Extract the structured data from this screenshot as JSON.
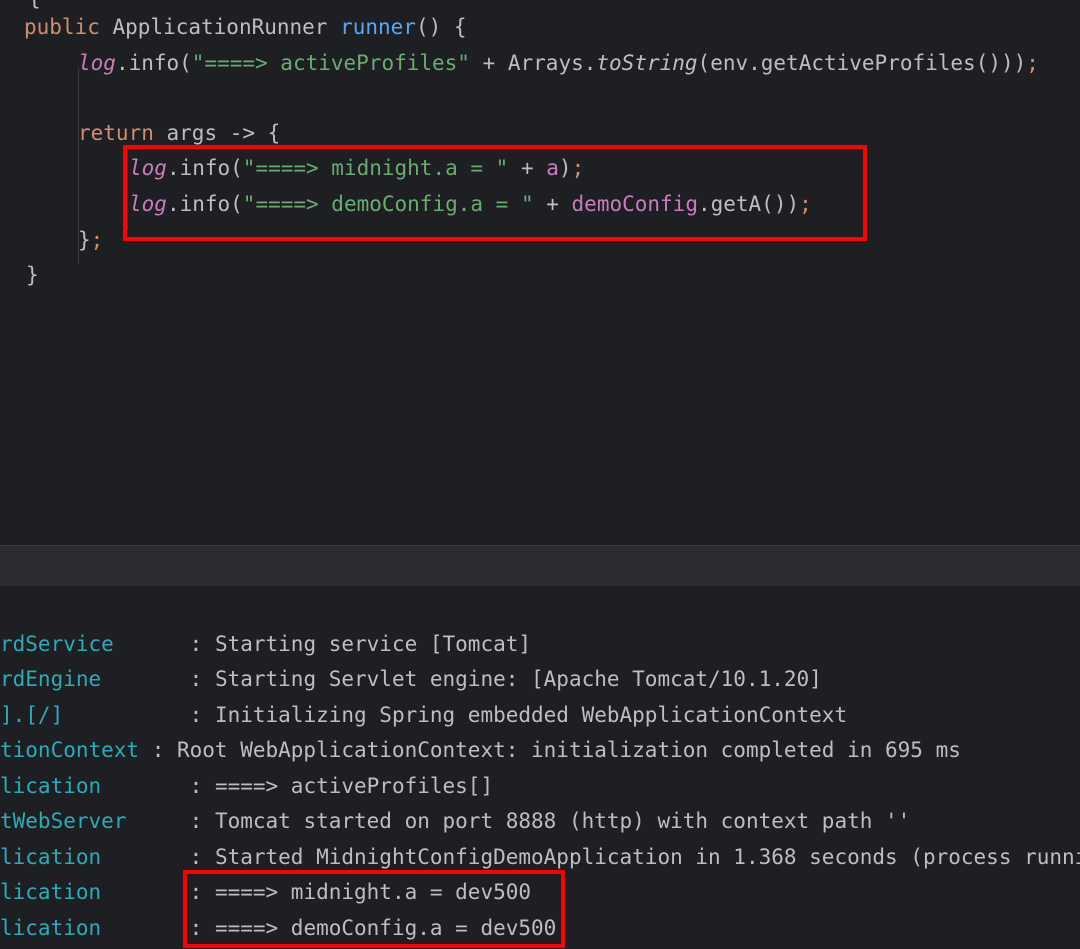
{
  "editor": {
    "partial_top": "{",
    "lines": {
      "l1": {
        "kw": "public ",
        "type": "ApplicationRunner ",
        "method": "runner",
        "rest": "() {"
      },
      "l2": {
        "log": "log",
        "dot": ".info(",
        "str": "\"====> activeProfiles\"",
        "plus": " + Arrays.",
        "sfn": "toString",
        "p1": "(env.getActiveProfiles()))",
        "semi": ";"
      },
      "l4": {
        "kw": "return ",
        "rest": "args -> {"
      },
      "l5": {
        "log": "log",
        "dot": ".info(",
        "str": "\"====> midnight.a = \"",
        "plus": " + ",
        "var": "a",
        "end": ")",
        "semi": ";"
      },
      "l6": {
        "log": "log",
        "dot": ".info(",
        "str": "\"====> demoConfig.a = \"",
        "plus": " + ",
        "var": "demoConfig",
        "end": ".getA())",
        "semi": ";"
      },
      "l7": {
        "brace": "}",
        "semi": ";"
      },
      "l8": {
        "brace": "}"
      }
    }
  },
  "console": {
    "lines": [
      {
        "logger": "rdService      ",
        "msg": ": Starting service [Tomcat]"
      },
      {
        "logger": "rdEngine       ",
        "msg": ": Starting Servlet engine: [Apache Tomcat/10.1.20]"
      },
      {
        "logger": "].[/]          ",
        "msg": ": Initializing Spring embedded WebApplicationContext"
      },
      {
        "logger": "tionContext ",
        "msg": ": Root WebApplicationContext: initialization completed in 695 ms"
      },
      {
        "logger": "lication       ",
        "msg": ": ====> activeProfiles[]"
      },
      {
        "logger": "tWebServer     ",
        "msg": ": Tomcat started on port 8888 (http) with context path ''"
      },
      {
        "logger": "lication       ",
        "msg": ": Started MidnightConfigDemoApplication in 1.368 seconds (process runnir"
      },
      {
        "logger": "lication       ",
        "msg": ": ====> midnight.a = dev500"
      },
      {
        "logger": "lication       ",
        "msg": ": ====> demoConfig.a = dev500"
      }
    ]
  },
  "colors": {
    "background": "#1e1f22",
    "keyword": "#cf8e6d",
    "method": "#56a8f5",
    "string": "#6aab73",
    "field": "#c77dbb",
    "logger": "#2aacb8",
    "highlight": "#ff0000"
  }
}
